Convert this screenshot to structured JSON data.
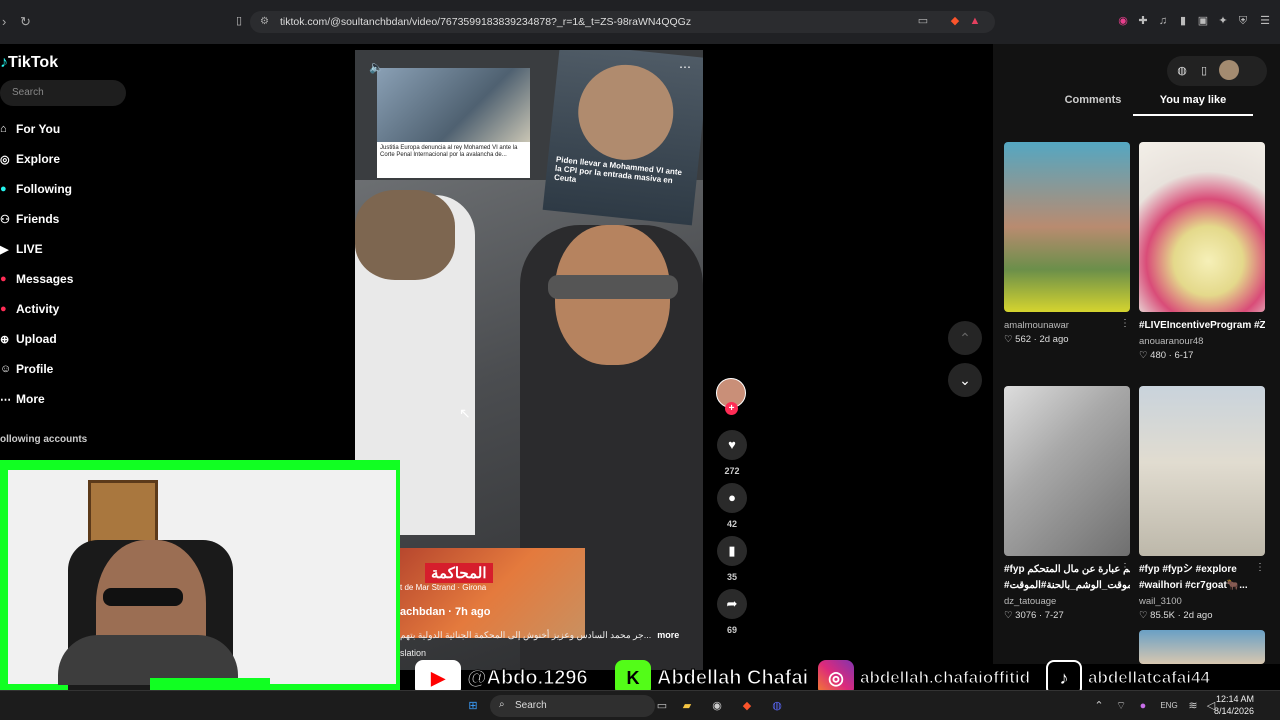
{
  "browser": {
    "url": "tiktok.com/@soultanchbdan/video/7673599183839234878?_r=1&_t=ZS-98raWN4QQGz"
  },
  "sidebar": {
    "logo": "TikTok",
    "search_placeholder": "Search",
    "items": [
      {
        "label": "For You",
        "icon": "home-icon"
      },
      {
        "label": "Explore",
        "icon": "compass-icon"
      },
      {
        "label": "Following",
        "icon": "following-icon"
      },
      {
        "label": "Friends",
        "icon": "friends-icon"
      },
      {
        "label": "LIVE",
        "icon": "live-icon"
      },
      {
        "label": "Messages",
        "icon": "messages-icon"
      },
      {
        "label": "Activity",
        "icon": "activity-icon"
      },
      {
        "label": "Upload",
        "icon": "upload-icon"
      },
      {
        "label": "Profile",
        "icon": "profile-icon"
      },
      {
        "label": "More",
        "icon": "more-icon"
      }
    ],
    "following_header": "ollowing accounts"
  },
  "video": {
    "news1_caption": "Justitia Europa denuncia al rey Mohamed VI ante la Corte Penal Internacional por la avalancha de...",
    "news2_caption": "Piden llevar a Mohammed VI ante la CPI por la entrada masiva en Ceuta",
    "news3_tag": "المحاكمة",
    "news3_sub": "t de Mar Strand · Girona",
    "author": "achbdan · 7h ago",
    "description": "جر محمد السادس وعزيز أخنوش إلى المحكمة الجنائية الدولية بتهم...",
    "more_label": "more",
    "translation": "slation"
  },
  "actions": {
    "likes": "272",
    "comments": "42",
    "saves": "35",
    "shares": "69"
  },
  "right_panel": {
    "tabs": [
      "Comments",
      "You may like"
    ],
    "cards": [
      {
        "title": "",
        "user": "amalmounawar",
        "meta": "562 · 2d ago"
      },
      {
        "title": "#LIVEIncentiveProgram #ZeroToHero...",
        "user": "anouaranour48",
        "meta": "480 · 6-17"
      },
      {
        "title": "#fyp وشم عبارة عن مال المتحكم",
        "title2": "#الموقت_الوشم_بالحنة#الموقت_#...",
        "user": "dz_tatouage",
        "meta": "3076 · 7-27"
      },
      {
        "title": "#fyp #fypシ #explore",
        "title2": "#wailhori #cr7goat🐂...",
        "user": "wail_3100",
        "meta": "85.5K · 2d ago"
      }
    ]
  },
  "social_bar": {
    "youtube": "@Abdo.1296",
    "kick": "Abdellah Chafai",
    "instagram": "abdellah.chafaioffitid",
    "tiktok": "abdellatcafai44"
  },
  "taskbar": {
    "search_placeholder": "Search",
    "lang": "ENG",
    "time": "12:14 AM",
    "date": "8/14/2026"
  },
  "colors": {
    "tiktok_red": "#fe2c55",
    "green_screen": "#11ff22"
  }
}
